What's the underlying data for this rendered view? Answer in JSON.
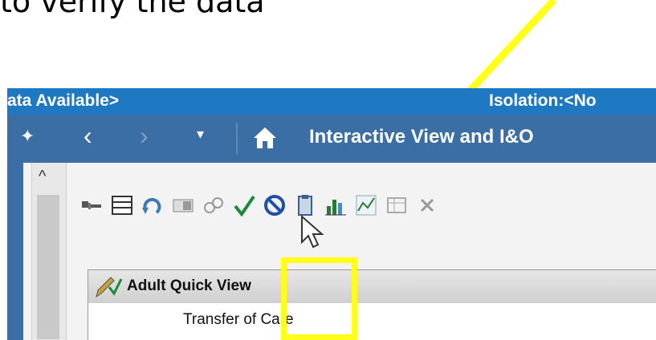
{
  "caption": "to verify the data",
  "banner": {
    "left_text": "ata Available>",
    "right_text": "Isolation:<No"
  },
  "nav": {
    "back_glyph": "‹",
    "forward_glyph": "›",
    "dropdown_glyph": "▾",
    "pin_glyph": "✦",
    "title": "Interactive View and I&O"
  },
  "scroll": {
    "up_glyph": "^"
  },
  "toolbar": {
    "icons": [
      "add-row-icon",
      "grid-icon",
      "refresh-icon",
      "document-icon",
      "link-icon",
      "sign-checkmark-icon",
      "cancel-icon",
      "clipboard-icon",
      "bar-chart-icon",
      "line-chart-icon",
      "table-icon",
      "close-icon"
    ]
  },
  "section": {
    "title": "Adult Quick View"
  },
  "rows": [
    {
      "label": "Transfer of Care"
    }
  ],
  "colors": {
    "banner_blue": "#1e78c2",
    "nav_blue": "#3a6ea5",
    "highlight_yellow": "#ffff1a",
    "check_green": "#1a8a3a"
  }
}
